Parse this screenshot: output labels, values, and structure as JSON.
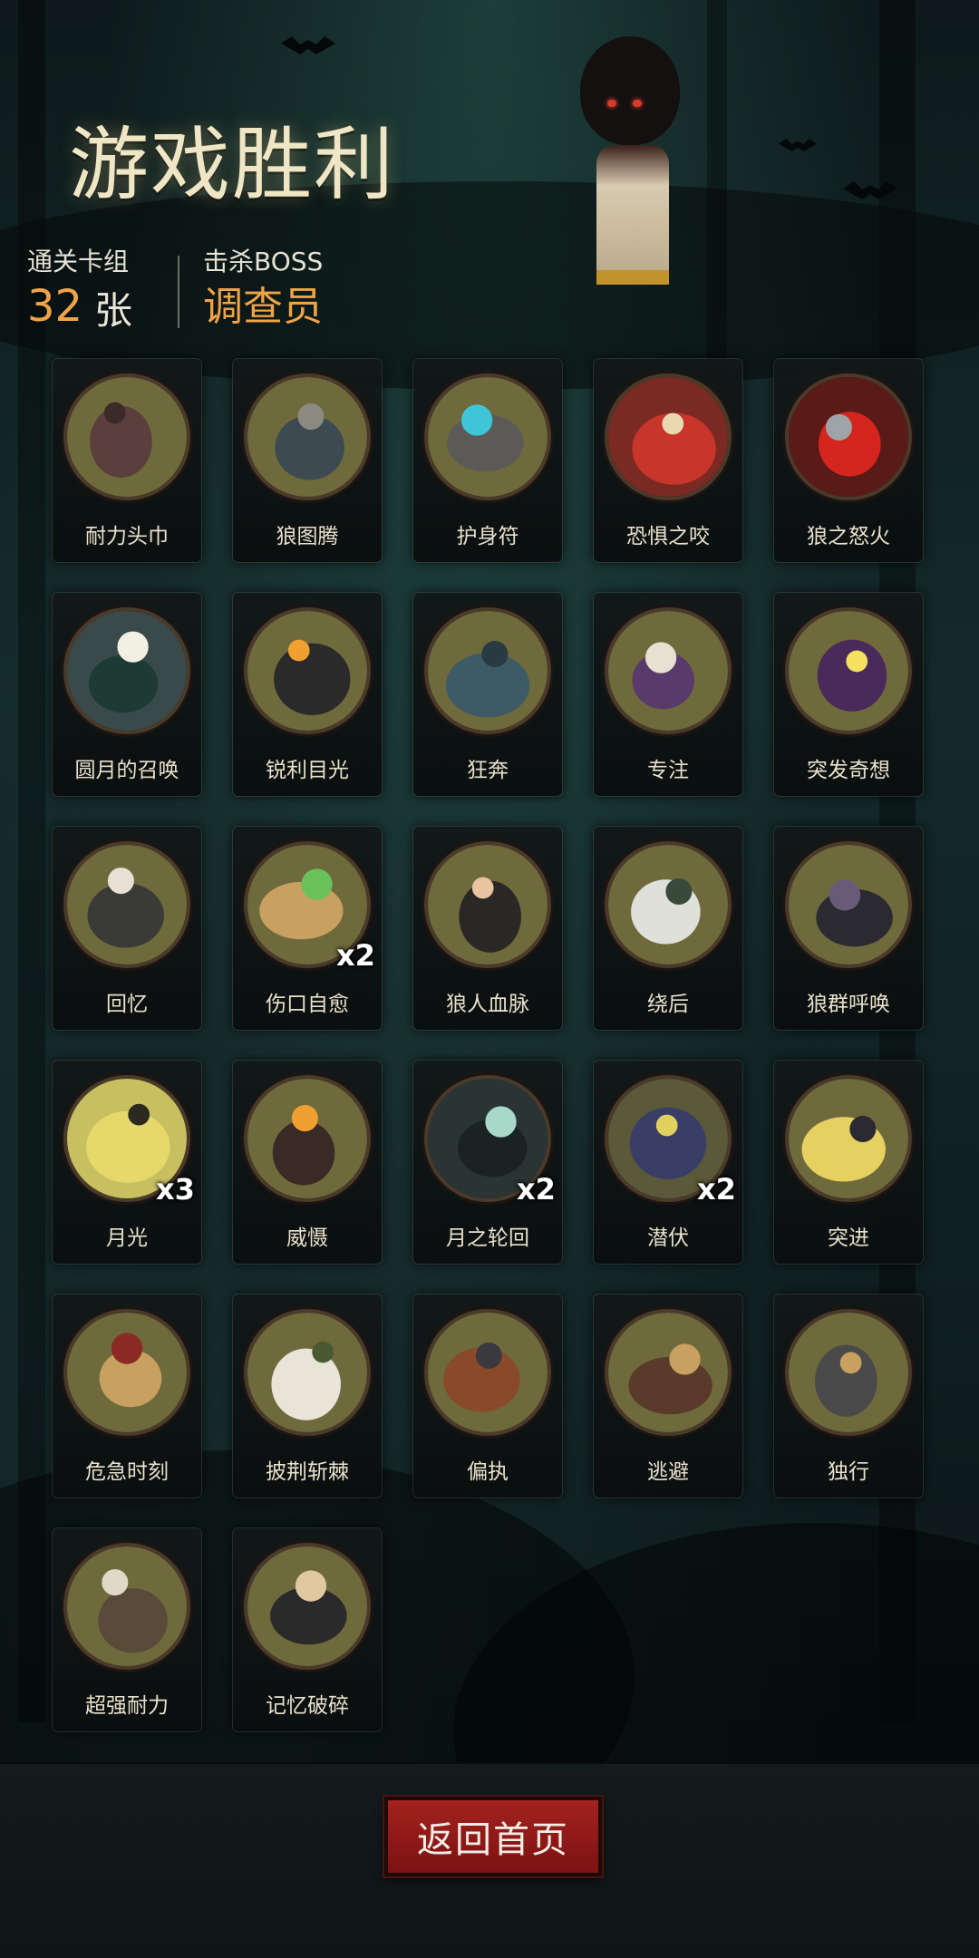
{
  "header": {
    "title": "游戏胜利",
    "cleared_deck_label": "通关卡组",
    "cleared_deck_count": "32",
    "cleared_deck_unit": "张",
    "boss_label": "击杀BOSS",
    "boss_name": "调查员"
  },
  "colors": {
    "accent": "#f0a347",
    "title": "#efe6c5",
    "button": "#9a1e1b",
    "card_art_bg": "#6d6a3e"
  },
  "cards": [
    {
      "name": "耐力头巾",
      "count": "",
      "icon": "bandana-icon"
    },
    {
      "name": "狼图腾",
      "count": "",
      "icon": "wolf-totem-icon"
    },
    {
      "name": "护身符",
      "count": "",
      "icon": "amulet-icon"
    },
    {
      "name": "恐惧之咬",
      "count": "",
      "icon": "fear-bite-icon"
    },
    {
      "name": "狼之怒火",
      "count": "",
      "icon": "wolf-rage-icon"
    },
    {
      "name": "圆月的召唤",
      "count": "",
      "icon": "full-moon-call-icon"
    },
    {
      "name": "锐利目光",
      "count": "",
      "icon": "sharp-gaze-icon"
    },
    {
      "name": "狂奔",
      "count": "",
      "icon": "sprint-icon"
    },
    {
      "name": "专注",
      "count": "",
      "icon": "focus-icon"
    },
    {
      "name": "突发奇想",
      "count": "",
      "icon": "idea-icon"
    },
    {
      "name": "回忆",
      "count": "",
      "icon": "memory-icon"
    },
    {
      "name": "伤口自愈",
      "count": "x2",
      "icon": "wound-heal-icon"
    },
    {
      "name": "狼人血脉",
      "count": "",
      "icon": "werewolf-blood-icon"
    },
    {
      "name": "绕后",
      "count": "",
      "icon": "flank-icon"
    },
    {
      "name": "狼群呼唤",
      "count": "",
      "icon": "pack-call-icon"
    },
    {
      "name": "月光",
      "count": "x3",
      "icon": "moonlight-icon"
    },
    {
      "name": "威慑",
      "count": "",
      "icon": "intimidate-icon"
    },
    {
      "name": "月之轮回",
      "count": "x2",
      "icon": "moon-cycle-icon"
    },
    {
      "name": "潜伏",
      "count": "x2",
      "icon": "lurk-icon"
    },
    {
      "name": "突进",
      "count": "",
      "icon": "dash-icon"
    },
    {
      "name": "危急时刻",
      "count": "",
      "icon": "crisis-icon"
    },
    {
      "name": "披荆斩棘",
      "count": "",
      "icon": "blaze-trail-icon"
    },
    {
      "name": "偏执",
      "count": "",
      "icon": "paranoia-icon"
    },
    {
      "name": "逃避",
      "count": "",
      "icon": "escape-icon"
    },
    {
      "name": "独行",
      "count": "",
      "icon": "lone-walk-icon"
    },
    {
      "name": "超强耐力",
      "count": "",
      "icon": "super-stamina-icon"
    },
    {
      "name": "记忆破碎",
      "count": "",
      "icon": "shattered-memory-icon"
    }
  ],
  "footer": {
    "home_button_label": "返回首页"
  }
}
